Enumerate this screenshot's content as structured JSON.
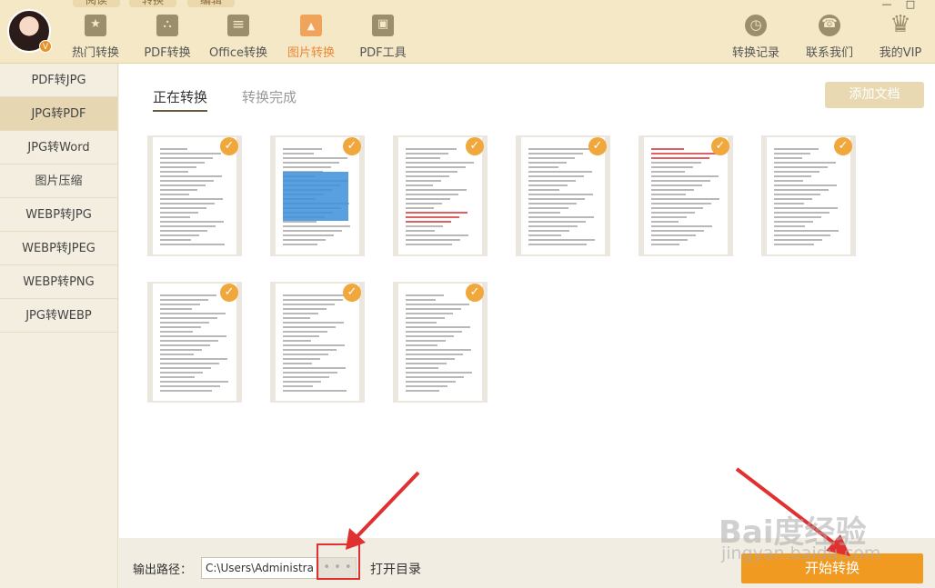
{
  "top_tabs": [
    "阅读",
    "转换",
    "编辑"
  ],
  "window_controls": {
    "minimize": "—",
    "maximize": "□"
  },
  "user": {
    "badge": "V"
  },
  "nav": [
    {
      "label": "热门转换",
      "icon": "fire-icon"
    },
    {
      "label": "PDF转换",
      "icon": "pdf-icon"
    },
    {
      "label": "Office转换",
      "icon": "office-icon"
    },
    {
      "label": "图片转换",
      "icon": "image-icon",
      "active": true
    },
    {
      "label": "PDF工具",
      "icon": "toolbox-icon"
    }
  ],
  "nav_right": [
    {
      "label": "转换记录",
      "icon": "clock-icon"
    },
    {
      "label": "联系我们",
      "icon": "headset-icon"
    },
    {
      "label": "我的VIP",
      "icon": "crown-icon"
    }
  ],
  "sidebar": [
    {
      "label": "PDF转JPG"
    },
    {
      "label": "JPG转PDF",
      "active": true
    },
    {
      "label": "JPG转Word"
    },
    {
      "label": "图片压缩"
    },
    {
      "label": "WEBP转JPG"
    },
    {
      "label": "WEBP转JPEG"
    },
    {
      "label": "WEBP转PNG"
    },
    {
      "label": "JPG转WEBP"
    }
  ],
  "tabs": {
    "active": "正在转换",
    "inactive": "转换完成"
  },
  "add_document": "添加文档",
  "files": {
    "count": 9,
    "selected_icon": "checkmark-icon",
    "check_glyph": "✓"
  },
  "footer": {
    "output_label": "输出路径：",
    "output_path": "C:\\Users\\Administrator",
    "browse": "• • •",
    "open_dir": "打开目录",
    "start": "开始转换"
  },
  "watermark": {
    "main": "Bai度经验",
    "sub": "jingyan.baidu.com"
  },
  "colors": {
    "accent": "#f09a22",
    "header_bg": "#f4e8c6",
    "highlight": "#e03030"
  }
}
